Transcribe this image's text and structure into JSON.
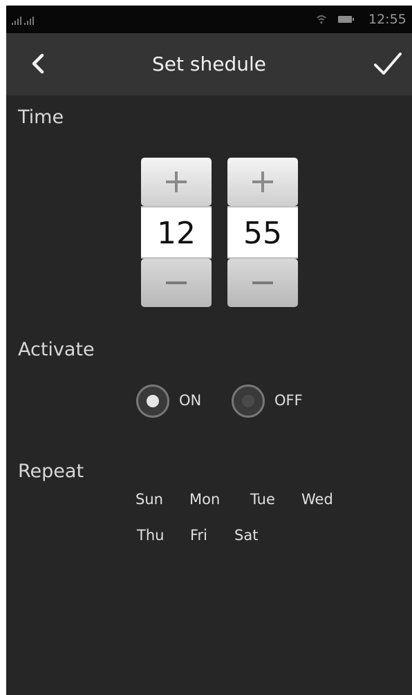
{
  "status_bar": {
    "time": "12:55"
  },
  "header": {
    "title": "Set shedule",
    "back_icon": "chevron-left-icon",
    "confirm_icon": "checkmark-icon"
  },
  "time_section": {
    "label": "Time",
    "hour": "12",
    "minute": "55",
    "increment_icon": "plus-icon",
    "decrement_icon": "minus-icon"
  },
  "activate_section": {
    "label": "Activate",
    "options": [
      "ON",
      "OFF"
    ],
    "selected": "ON"
  },
  "repeat_section": {
    "label": "Repeat",
    "days": [
      "Sun",
      "Mon",
      "Tue",
      "Wed",
      "Thu",
      "Fri",
      "Sat"
    ]
  },
  "colors": {
    "background": "#262626",
    "header": "#343434",
    "status_bar": "#080808"
  }
}
